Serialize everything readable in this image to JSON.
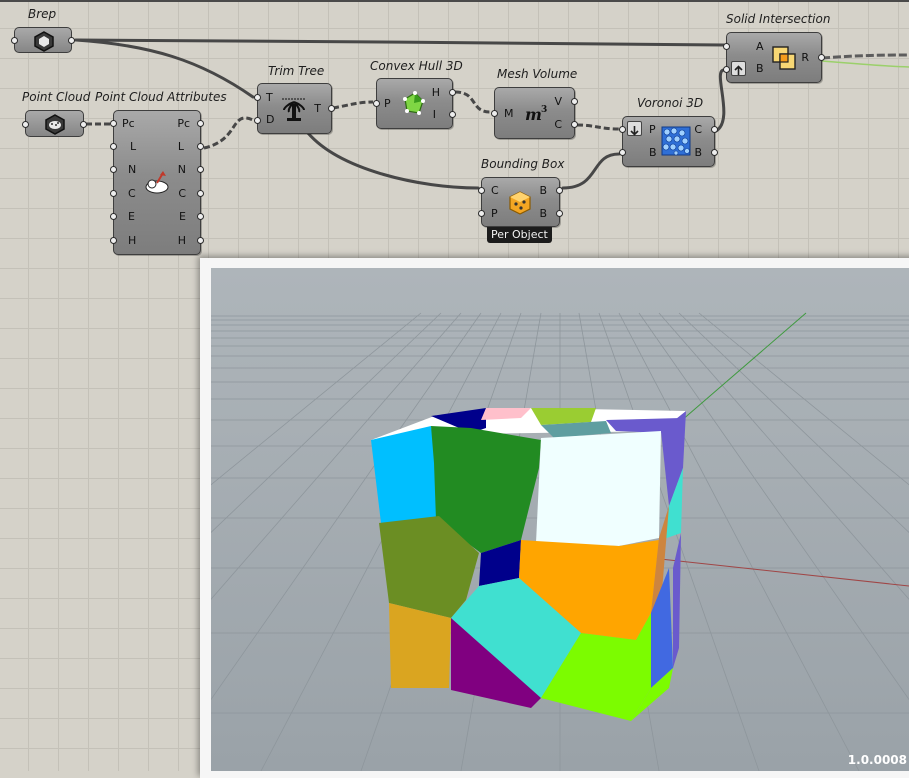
{
  "components": {
    "brep": {
      "title": "Brep",
      "icon": "brep-icon"
    },
    "point_cloud": {
      "title": "Point Cloud",
      "icon": "point-cloud-icon"
    },
    "point_cloud_attributes": {
      "title": "Point Cloud Attributes",
      "icon": "point-cloud-attributes-icon",
      "inputs": [
        "Pc",
        "L",
        "N",
        "C",
        "E",
        "H"
      ],
      "outputs": [
        "Pc",
        "L",
        "N",
        "C",
        "E",
        "H"
      ]
    },
    "trim_tree": {
      "title": "Trim Tree",
      "icon": "trim-tree-icon",
      "inputs": [
        "T",
        "D"
      ],
      "outputs": [
        "T"
      ]
    },
    "convex_hull": {
      "title": "Convex Hull 3D",
      "icon": "convex-hull-icon",
      "inputs": [
        "P"
      ],
      "outputs": [
        "H",
        "I"
      ]
    },
    "mesh_volume": {
      "title": "Mesh Volume",
      "icon": "mesh-volume-icon",
      "inputs": [
        "M"
      ],
      "outputs": [
        "V",
        "C"
      ]
    },
    "bounding_box": {
      "title": "Bounding Box",
      "icon": "bounding-box-icon",
      "inputs": [
        "C",
        "P"
      ],
      "outputs": [
        "B",
        "B"
      ],
      "tag": "Per Object"
    },
    "voronoi": {
      "title": "Voronoi 3D",
      "icon": "voronoi-icon",
      "inputs": [
        "P",
        "B"
      ],
      "outputs": [
        "C",
        "B"
      ]
    },
    "solid_intersection": {
      "title": "Solid Intersection",
      "icon": "solid-intersection-icon",
      "inputs": [
        "A",
        "B"
      ],
      "outputs": [
        "R"
      ]
    }
  },
  "viewport": {
    "version": "1.0.0008",
    "background": "#9fa7ad",
    "cells": [
      "#00bfff",
      "#00008b",
      "#228b22",
      "#f0ffff",
      "#6b8e23",
      "#ffa500",
      "#40e0d0",
      "#800080",
      "#7cfc00",
      "#daa520",
      "#6a5acd",
      "#4169e1",
      "#ffc0cb",
      "#9acd32"
    ]
  }
}
